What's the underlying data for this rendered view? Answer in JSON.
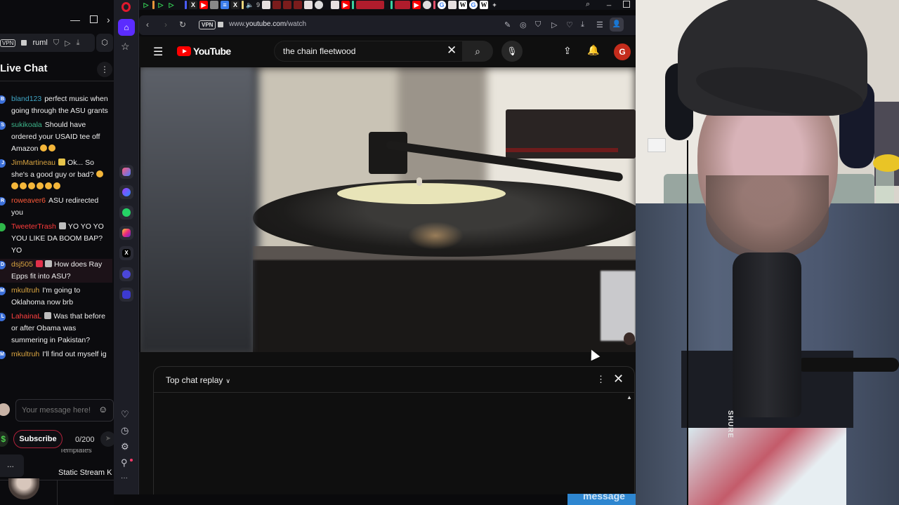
{
  "stream_chat_window": {
    "address_bar": {
      "vpn_label": "VPN",
      "domain": "ruml"
    },
    "header": {
      "title": "Live Chat"
    },
    "messages": [
      {
        "avatar_letter": "B",
        "user": "bland123",
        "user_color": "#3fa7c7",
        "text": "perfect music when going through the ASU grants",
        "badges": [],
        "emojis": 0
      },
      {
        "avatar_letter": "S",
        "user": "sukikoala",
        "user_color": "#3db58a",
        "text": "Should have ordered your USAID tee off Amazon",
        "badges": [],
        "emojis": 2
      },
      {
        "avatar_letter": "J",
        "user": "JimMartineau",
        "user_color": "#d9a440",
        "text": "Ok... So she's a good guy or bad?",
        "badges": [
          "#e6c34a"
        ],
        "emojis": 7
      },
      {
        "avatar_letter": "R",
        "user": "roweaver6",
        "user_color": "#ff5a3a",
        "text": "ASU redirected you",
        "badges": [],
        "emojis": 0
      },
      {
        "avatar_letter": "",
        "user": "TweeterTrash",
        "user_color": "#ff3b3b",
        "text": "YO YO YO YOU LIKE DA BOOM BAP? YO",
        "badges": [
          "#bdbdbd"
        ],
        "emojis": 0
      },
      {
        "avatar_letter": "D",
        "user": "dsj505",
        "user_color": "#d9a440",
        "text": "How does Ray Epps fit into ASU?",
        "badges": [
          "#e0304a",
          "#bdbdbd"
        ],
        "emojis": 0,
        "highlighted": true
      },
      {
        "avatar_letter": "M",
        "user": "mkultruh",
        "user_color": "#d9a440",
        "text": "I'm going to Oklahoma now brb",
        "badges": [],
        "emojis": 0
      },
      {
        "avatar_letter": "L",
        "user": "LahainaL",
        "user_color": "#ff4040",
        "text": "Was that before or after Obama was summering in Pakistan?",
        "badges": [
          "#bdbdbd"
        ],
        "emojis": 0
      },
      {
        "avatar_letter": "M",
        "user": "mkultruh",
        "user_color": "#d9a440",
        "text": "I'll find out myself ig",
        "badges": [],
        "emojis": 0
      }
    ],
    "input": {
      "placeholder": "Your message here!",
      "value": ""
    },
    "subscribe_label": "Subscribe",
    "char_count": "0/200",
    "dock_more_label": "...",
    "templates_label": "Templates",
    "static_stream_label": "Static Stream K"
  },
  "browser": {
    "tab_count": "9",
    "address": {
      "vpn_label": "VPN",
      "url_prefix": "www.",
      "url_domain": "youtube.com",
      "url_path": "/watch"
    },
    "icons": {
      "back": "‹",
      "forward": "›",
      "reload": "↻",
      "tools": [
        "✎",
        "◎",
        "⛉",
        "▷",
        "♡",
        "⤓",
        "☰"
      ],
      "profile": "👤"
    },
    "sidebar_bottom": [
      "♡",
      "◷",
      "⚙",
      "⚲",
      "···"
    ]
  },
  "youtube": {
    "brand": "YouTube",
    "search": {
      "value": "the chain fleetwood",
      "placeholder": "Search"
    },
    "avatar_letter": "G",
    "chat_panel": {
      "title": "Top chat replay"
    }
  },
  "overlay": {
    "blue_strip_text": "message"
  },
  "webcam": {
    "mic_brand": "SHURE"
  }
}
